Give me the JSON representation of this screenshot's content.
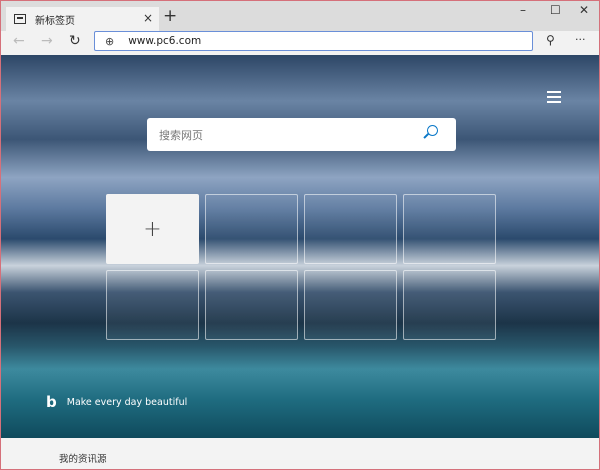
{
  "tab": {
    "title": "新标签页",
    "close": "×",
    "new": "+"
  },
  "window": {
    "minimize": "–",
    "maximize": "☐",
    "close": "✕"
  },
  "nav": {
    "back": "←",
    "forward": "→",
    "refresh": "↻",
    "url": "www.pc6.com",
    "profile": "⚲",
    "more": "···"
  },
  "search": {
    "placeholder": "搜索网页"
  },
  "tiles": {
    "add": "+"
  },
  "bing": {
    "logo": "b",
    "tagline": "Make every day beautiful"
  },
  "feed": {
    "label": "我的资讯源"
  }
}
